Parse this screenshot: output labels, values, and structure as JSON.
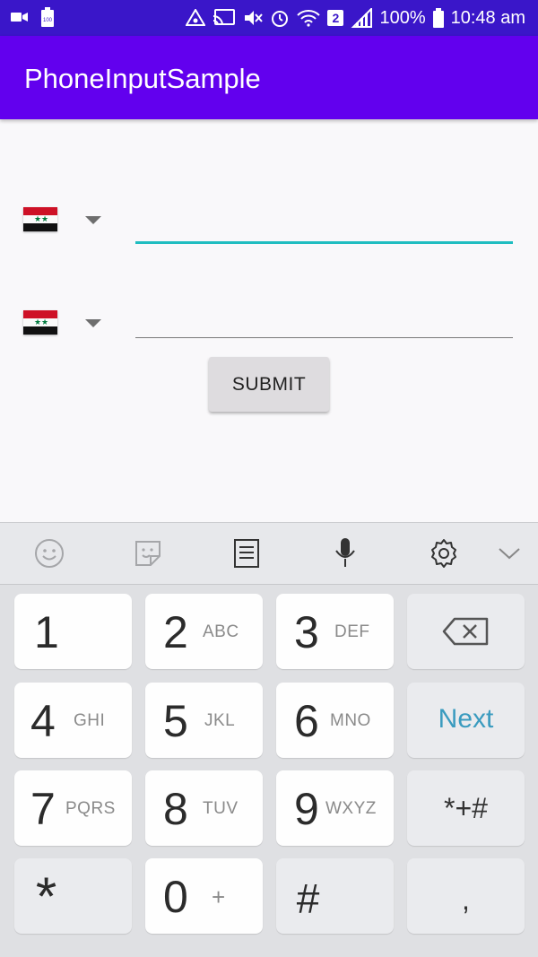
{
  "status_bar": {
    "battery_percent": "100%",
    "time": "10:48 am",
    "sim_badge": "2",
    "left_icons": [
      "video-camera-icon",
      "battery-saver-icon"
    ],
    "right_icons": [
      "data-saver-icon",
      "cast-icon",
      "mute-icon",
      "alarm-icon",
      "wifi-icon",
      "signal-icon",
      "battery-icon"
    ]
  },
  "app_bar": {
    "title": "PhoneInputSample"
  },
  "form": {
    "phone_1": {
      "value": "",
      "placeholder": "",
      "country_flag": "syria-flag"
    },
    "phone_2": {
      "value": "",
      "placeholder": "",
      "country_flag": "syria-flag"
    },
    "submit_label": "SUBMIT"
  },
  "keyboard": {
    "toolbar_icons": [
      "emoji-icon",
      "sticker-icon",
      "clipboard-icon",
      "microphone-icon",
      "settings-icon",
      "chevron-down-icon"
    ],
    "keys": [
      {
        "num": "1",
        "letters": ""
      },
      {
        "num": "2",
        "letters": "ABC"
      },
      {
        "num": "3",
        "letters": "DEF"
      },
      {
        "num": "4",
        "letters": "GHI"
      },
      {
        "num": "5",
        "letters": "JKL"
      },
      {
        "num": "6",
        "letters": "MNO"
      },
      {
        "num": "7",
        "letters": "PQRS"
      },
      {
        "num": "8",
        "letters": "TUV"
      },
      {
        "num": "9",
        "letters": "WXYZ"
      },
      {
        "num": "0",
        "letters": "+"
      }
    ],
    "next_label": "Next",
    "symbols_label": "*+#",
    "star_label": "*",
    "hash_label": "#",
    "comma_label": ","
  },
  "colors": {
    "status_bar": "#3a16c9",
    "app_bar": "#6200ee",
    "field_accent": "#1fbdc0",
    "next_key_text": "#3a9bbf"
  }
}
